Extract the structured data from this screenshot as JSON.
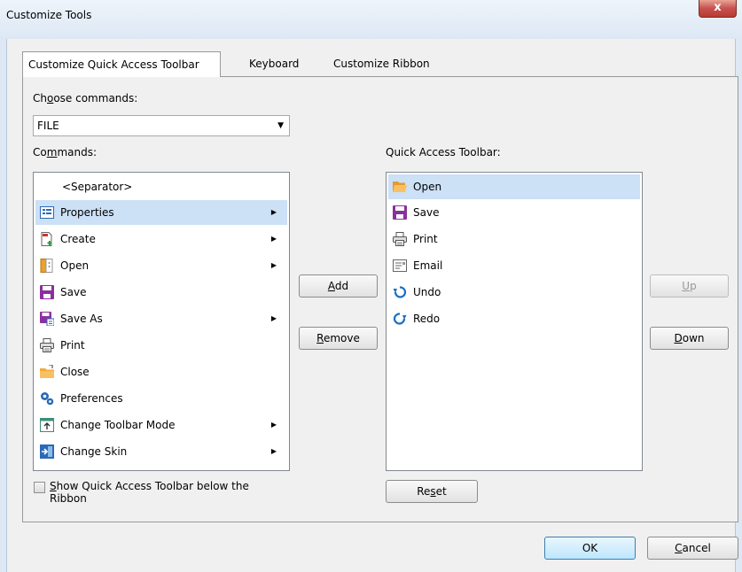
{
  "window": {
    "title": "Customize Tools",
    "close_glyph": "x"
  },
  "tabs": [
    {
      "label": "Customize Quick Access Toolbar",
      "active": true
    },
    {
      "label": "Keyboard",
      "active": false
    },
    {
      "label": "Customize Ribbon",
      "active": false
    }
  ],
  "choose": {
    "label_pre": "Ch",
    "label_u": "o",
    "label_post": "ose commands:",
    "value": "FILE"
  },
  "commands": {
    "label_pre": "Co",
    "label_u": "m",
    "label_post": "mands:",
    "items": [
      {
        "label": "<Separator>",
        "icon": "",
        "submenu": false
      },
      {
        "label": "Properties",
        "icon": "properties-icon",
        "submenu": true
      },
      {
        "label": "Create",
        "icon": "create-pdf-icon",
        "submenu": true
      },
      {
        "label": "Open",
        "icon": "open-book-icon",
        "submenu": true
      },
      {
        "label": "Save",
        "icon": "save-icon",
        "submenu": false
      },
      {
        "label": "Save As",
        "icon": "save-as-icon",
        "submenu": true
      },
      {
        "label": "Print",
        "icon": "print-icon",
        "submenu": false
      },
      {
        "label": "Close",
        "icon": "close-folder-icon",
        "submenu": false
      },
      {
        "label": "Preferences",
        "icon": "preferences-icon",
        "submenu": false
      },
      {
        "label": "Change Toolbar Mode",
        "icon": "toolbar-mode-icon",
        "submenu": true
      },
      {
        "label": "Change Skin",
        "icon": "change-skin-icon",
        "submenu": true
      }
    ]
  },
  "qat": {
    "label": "Quick Access Toolbar:",
    "items": [
      {
        "label": "Open",
        "icon": "open-folder-icon"
      },
      {
        "label": "Save",
        "icon": "save-icon"
      },
      {
        "label": "Print",
        "icon": "print-icon"
      },
      {
        "label": "Email",
        "icon": "email-icon"
      },
      {
        "label": "Undo",
        "icon": "undo-icon"
      },
      {
        "label": "Redo",
        "icon": "redo-icon"
      }
    ]
  },
  "buttons": {
    "add_u": "A",
    "add_rest": "dd",
    "remove_u": "R",
    "remove_rest": "emove",
    "up_u": "U",
    "up_rest": "p",
    "down_u": "D",
    "down_rest": "own",
    "reset_pre": "Re",
    "reset_u": "s",
    "reset_post": "et",
    "ok": "OK",
    "cancel_u": "C",
    "cancel_rest": "ancel"
  },
  "checkbox": {
    "label_u": "S",
    "label_rest": "how Quick Access Toolbar below the Ribbon",
    "checked": false
  },
  "colors": {
    "selection": "#cce0f6",
    "save_purple": "#8b2f9f",
    "undo_blue": "#1b6fc4",
    "folder_orange": "#f2a93b"
  }
}
